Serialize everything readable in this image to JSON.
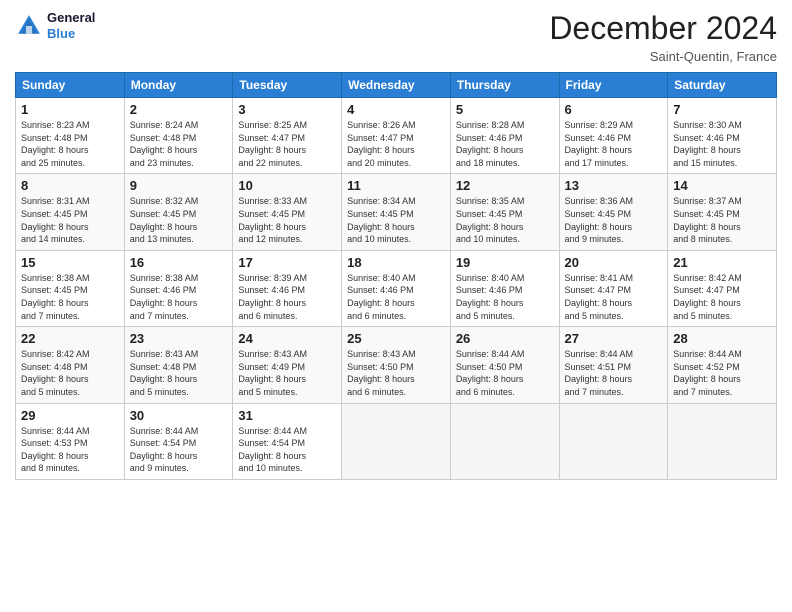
{
  "header": {
    "logo_line1": "General",
    "logo_line2": "Blue",
    "month_title": "December 2024",
    "subtitle": "Saint-Quentin, France"
  },
  "days_of_week": [
    "Sunday",
    "Monday",
    "Tuesday",
    "Wednesday",
    "Thursday",
    "Friday",
    "Saturday"
  ],
  "weeks": [
    [
      {
        "day": 1,
        "info": "Sunrise: 8:23 AM\nSunset: 4:48 PM\nDaylight: 8 hours\nand 25 minutes."
      },
      {
        "day": 2,
        "info": "Sunrise: 8:24 AM\nSunset: 4:48 PM\nDaylight: 8 hours\nand 23 minutes."
      },
      {
        "day": 3,
        "info": "Sunrise: 8:25 AM\nSunset: 4:47 PM\nDaylight: 8 hours\nand 22 minutes."
      },
      {
        "day": 4,
        "info": "Sunrise: 8:26 AM\nSunset: 4:47 PM\nDaylight: 8 hours\nand 20 minutes."
      },
      {
        "day": 5,
        "info": "Sunrise: 8:28 AM\nSunset: 4:46 PM\nDaylight: 8 hours\nand 18 minutes."
      },
      {
        "day": 6,
        "info": "Sunrise: 8:29 AM\nSunset: 4:46 PM\nDaylight: 8 hours\nand 17 minutes."
      },
      {
        "day": 7,
        "info": "Sunrise: 8:30 AM\nSunset: 4:46 PM\nDaylight: 8 hours\nand 15 minutes."
      }
    ],
    [
      {
        "day": 8,
        "info": "Sunrise: 8:31 AM\nSunset: 4:45 PM\nDaylight: 8 hours\nand 14 minutes."
      },
      {
        "day": 9,
        "info": "Sunrise: 8:32 AM\nSunset: 4:45 PM\nDaylight: 8 hours\nand 13 minutes."
      },
      {
        "day": 10,
        "info": "Sunrise: 8:33 AM\nSunset: 4:45 PM\nDaylight: 8 hours\nand 12 minutes."
      },
      {
        "day": 11,
        "info": "Sunrise: 8:34 AM\nSunset: 4:45 PM\nDaylight: 8 hours\nand 10 minutes."
      },
      {
        "day": 12,
        "info": "Sunrise: 8:35 AM\nSunset: 4:45 PM\nDaylight: 8 hours\nand 10 minutes."
      },
      {
        "day": 13,
        "info": "Sunrise: 8:36 AM\nSunset: 4:45 PM\nDaylight: 8 hours\nand 9 minutes."
      },
      {
        "day": 14,
        "info": "Sunrise: 8:37 AM\nSunset: 4:45 PM\nDaylight: 8 hours\nand 8 minutes."
      }
    ],
    [
      {
        "day": 15,
        "info": "Sunrise: 8:38 AM\nSunset: 4:45 PM\nDaylight: 8 hours\nand 7 minutes."
      },
      {
        "day": 16,
        "info": "Sunrise: 8:38 AM\nSunset: 4:46 PM\nDaylight: 8 hours\nand 7 minutes."
      },
      {
        "day": 17,
        "info": "Sunrise: 8:39 AM\nSunset: 4:46 PM\nDaylight: 8 hours\nand 6 minutes."
      },
      {
        "day": 18,
        "info": "Sunrise: 8:40 AM\nSunset: 4:46 PM\nDaylight: 8 hours\nand 6 minutes."
      },
      {
        "day": 19,
        "info": "Sunrise: 8:40 AM\nSunset: 4:46 PM\nDaylight: 8 hours\nand 5 minutes."
      },
      {
        "day": 20,
        "info": "Sunrise: 8:41 AM\nSunset: 4:47 PM\nDaylight: 8 hours\nand 5 minutes."
      },
      {
        "day": 21,
        "info": "Sunrise: 8:42 AM\nSunset: 4:47 PM\nDaylight: 8 hours\nand 5 minutes."
      }
    ],
    [
      {
        "day": 22,
        "info": "Sunrise: 8:42 AM\nSunset: 4:48 PM\nDaylight: 8 hours\nand 5 minutes."
      },
      {
        "day": 23,
        "info": "Sunrise: 8:43 AM\nSunset: 4:48 PM\nDaylight: 8 hours\nand 5 minutes."
      },
      {
        "day": 24,
        "info": "Sunrise: 8:43 AM\nSunset: 4:49 PM\nDaylight: 8 hours\nand 5 minutes."
      },
      {
        "day": 25,
        "info": "Sunrise: 8:43 AM\nSunset: 4:50 PM\nDaylight: 8 hours\nand 6 minutes."
      },
      {
        "day": 26,
        "info": "Sunrise: 8:44 AM\nSunset: 4:50 PM\nDaylight: 8 hours\nand 6 minutes."
      },
      {
        "day": 27,
        "info": "Sunrise: 8:44 AM\nSunset: 4:51 PM\nDaylight: 8 hours\nand 7 minutes."
      },
      {
        "day": 28,
        "info": "Sunrise: 8:44 AM\nSunset: 4:52 PM\nDaylight: 8 hours\nand 7 minutes."
      }
    ],
    [
      {
        "day": 29,
        "info": "Sunrise: 8:44 AM\nSunset: 4:53 PM\nDaylight: 8 hours\nand 8 minutes."
      },
      {
        "day": 30,
        "info": "Sunrise: 8:44 AM\nSunset: 4:54 PM\nDaylight: 8 hours\nand 9 minutes."
      },
      {
        "day": 31,
        "info": "Sunrise: 8:44 AM\nSunset: 4:54 PM\nDaylight: 8 hours\nand 10 minutes."
      },
      null,
      null,
      null,
      null
    ]
  ]
}
